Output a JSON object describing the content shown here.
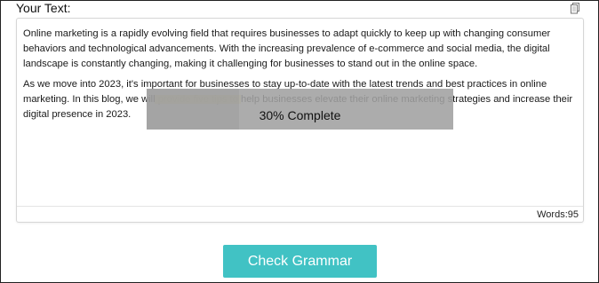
{
  "editor": {
    "label": "Your Text:",
    "copy_icon": "copy-icon",
    "paragraphs": [
      "Online marketing is a rapidly evolving field that requires businesses to adapt quickly to keep up with changing consumer behaviors and technological advancements. With the increasing prevalence of e-commerce and social media, the digital landscape is constantly changing, making it challenging for businesses to stand out in the online space.",
      "As we move into 2023, it's important for businesses to stay up-to-date with the latest trends and best practices in online marketing. In this blog, we will provide five tips to help businesses elevate their online marketing strategies and increase their digital presence in 2023."
    ],
    "word_count_label": "Words:",
    "word_count_value": "95"
  },
  "progress": {
    "percent": 30,
    "text": "30% Complete",
    "overlay_color": "#a0a0a0"
  },
  "actions": {
    "check_grammar_label": "Check Grammar",
    "button_color": "#41c2c4"
  }
}
